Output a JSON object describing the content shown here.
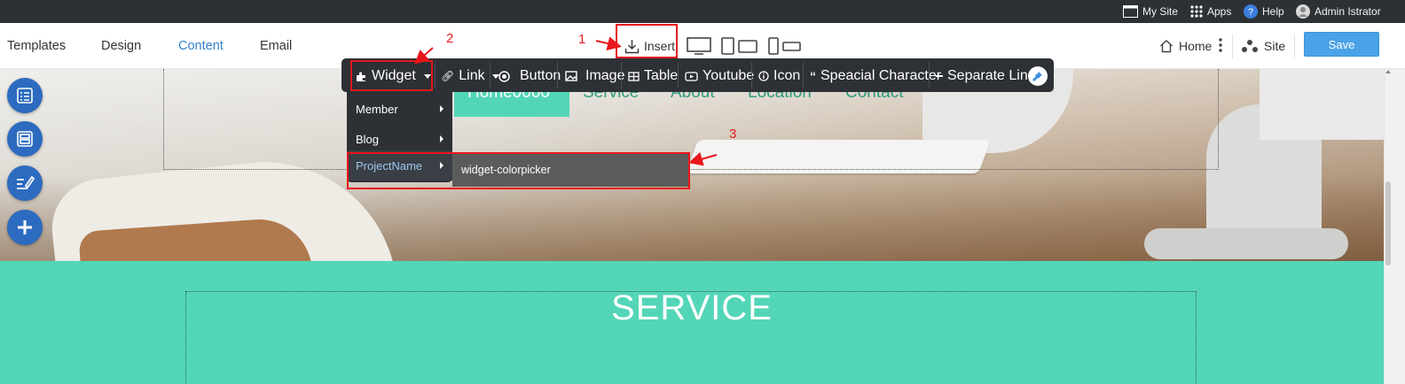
{
  "admin_bar": {
    "my_site": "My Site",
    "apps": "Apps",
    "help": "Help",
    "user": "Admin Istrator"
  },
  "editor_nav": {
    "tabs": [
      "Templates",
      "Design",
      "Content",
      "Email"
    ],
    "active_tab": "Content",
    "insert_label": "Insert",
    "home_label": "Home",
    "site_label": "Site",
    "save_label": "Save"
  },
  "insert_toolbar": {
    "widget": "Widget",
    "link": "Link",
    "button": "Button",
    "image": "Image",
    "table": "Table",
    "youtube": "Youtube",
    "icon": "Icon",
    "special_character": "Speacial Character",
    "separate_line": "Separate Line"
  },
  "widget_menu": {
    "items": [
      "Member",
      "Blog",
      "ProjectName"
    ],
    "highlighted": "ProjectName",
    "submenu_item": "widget-colorpicker"
  },
  "site_nav": {
    "items": [
      "Home0000",
      "Service",
      "About",
      "Location",
      "Contact"
    ]
  },
  "service": {
    "title": "SERVICE"
  },
  "annotations": {
    "num1": "1",
    "num2": "2",
    "num3": "3",
    "color": "#e8161d"
  },
  "colors": {
    "accent": "#53d6b7",
    "primary_blue": "#2c6bbf",
    "save_blue": "#4aa3e6",
    "toolbar_dark": "#2d3035"
  }
}
